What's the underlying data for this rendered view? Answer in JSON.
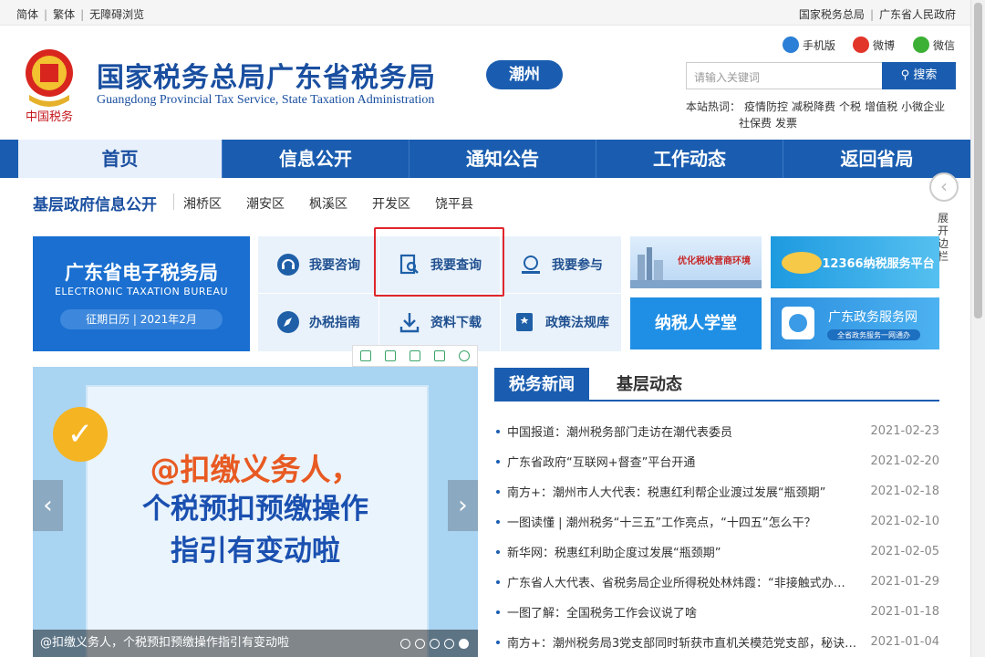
{
  "topbar": {
    "left": [
      "简体",
      "繁体",
      "无障碍浏览"
    ],
    "right": [
      "国家税务总局",
      "广东省人民政府"
    ]
  },
  "header": {
    "logo_text": "中国税务",
    "title": "国家税务总局广东省税务局",
    "subtitle": "Guangdong Provincial Tax Service, State Taxation Administration",
    "city": "潮州",
    "share": [
      "手机版",
      "微博",
      "微信"
    ],
    "search_placeholder": "请输入关键词",
    "search_button": "搜索",
    "hot_label": "本站热词：",
    "hot_words": [
      "疫情防控",
      "减税降费",
      "个税",
      "增值税",
      "小微企业",
      "社保费",
      "发票"
    ]
  },
  "nav": [
    "首页",
    "信息公开",
    "通知公告",
    "工作动态",
    "返回省局"
  ],
  "side": {
    "label": "展开边栏"
  },
  "local": {
    "title": "基层政府信息公开",
    "links": [
      "湘桥区",
      "潮安区",
      "枫溪区",
      "开发区",
      "饶平县"
    ]
  },
  "etax": {
    "title": "广东省电子税务局",
    "subtitle": "ELECTRONIC TAXATION BUREAU",
    "badge": "征期日历 | 2021年2月"
  },
  "services": [
    "我要咨询",
    "我要查询",
    "我要参与",
    "办税指南",
    "资料下载",
    "政策法规库"
  ],
  "banners": {
    "b1": "优化税收营商环境",
    "b2": "12366纳税服务平台",
    "b3": "纳税人学堂",
    "b4_title": "广东政务服务网",
    "b4_sub": "全省政务服务一网通办"
  },
  "slider": {
    "line1": "@扣缴义务人，",
    "line2": "个税预扣预缴操作",
    "line3": "指引有变动啦",
    "caption": "@扣缴义务人，个税预扣预缴操作指引有变动啦",
    "slide_count": 5,
    "current_slide": 5
  },
  "news": {
    "tabs": [
      "税务新闻",
      "基层动态"
    ],
    "items": [
      {
        "title": "中国报道：潮州税务部门走访在潮代表委员",
        "date": "2021-02-23"
      },
      {
        "title": "广东省政府“互联网+督查”平台开通",
        "date": "2021-02-20"
      },
      {
        "title": "南方+：潮州市人大代表：税惠红利帮企业渡过发展“瓶颈期”",
        "date": "2021-02-18"
      },
      {
        "title": "一图读懂 | 潮州税务“十三五”工作亮点，“十四五”怎么干？",
        "date": "2021-02-10"
      },
      {
        "title": "新华网：税惠红利助企度过发展“瓶颈期”",
        "date": "2021-02-05"
      },
      {
        "title": "广东省人大代表、省税务局企业所得税处林炜霞：“非接触式办…",
        "date": "2021-01-29"
      },
      {
        "title": "一图了解：全国税务工作会议说了啥",
        "date": "2021-01-18"
      },
      {
        "title": "南方+：潮州税务局3党支部同时斩获市直机关模范党支部，秘诀…",
        "date": "2021-01-04"
      }
    ]
  },
  "colors": {
    "primary": "#1a5db0",
    "highlight": "#e0262b",
    "accent": "#e85a22"
  }
}
